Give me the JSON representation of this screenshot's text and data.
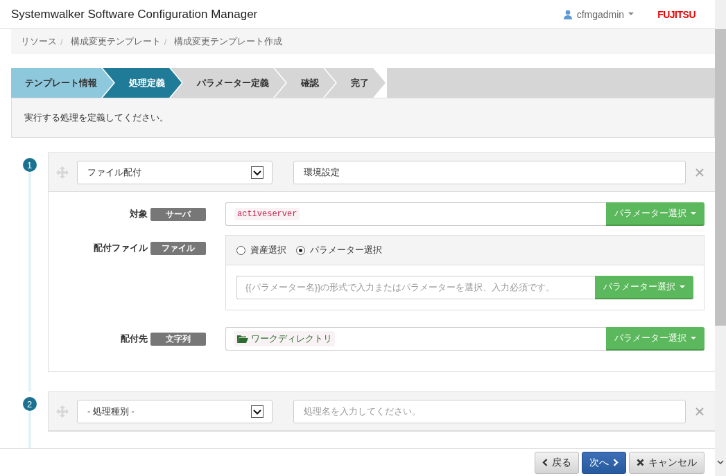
{
  "header": {
    "title": "Systemwalker Software Configuration Manager",
    "user": "cfmgadmin",
    "logo": "FUJITSU"
  },
  "breadcrumb": [
    {
      "label": "リソース",
      "separator": "/"
    },
    {
      "label": "構成変更テンプレート",
      "separator": "/"
    },
    {
      "label": "構成変更テンプレート作成"
    }
  ],
  "steps": [
    {
      "label": "テンプレート情報",
      "completed": true,
      "selected": false
    },
    {
      "label": "処理定義",
      "selected": true
    },
    {
      "label": "パラメーター定義",
      "completed": false,
      "selected": false
    },
    {
      "label": "確認",
      "completed": false,
      "selected": false
    },
    {
      "label": "完了",
      "completed": false,
      "selected": false
    }
  ],
  "instruction": "実行する処理を定義してください。",
  "processes": [
    {
      "number": "1",
      "type": "ファイル配付",
      "name": "環境設定",
      "fields": [
        {
          "kind": "param",
          "label": "対象",
          "type": "サーバ",
          "value": {
            "kind": "code",
            "text": "activeserver"
          },
          "button": "パラメーター選択"
        },
        {
          "kind": "choice",
          "label": "配付ファイル",
          "type": "ファイル",
          "options": [
            {
              "label": "資産選択",
              "selected": false
            },
            {
              "label": "パラメーター選択",
              "selected": true
            }
          ],
          "placeholder": "{{パラメーター名}}の形式で入力またはパラメーターを選択、入力必須です。",
          "button": "パラメーター選択"
        },
        {
          "kind": "param",
          "label": "配付先",
          "type": "文字列",
          "value": {
            "kind": "folder",
            "text": "ワークディレクトリ"
          },
          "button": "パラメーター選択"
        }
      ]
    },
    {
      "number": "2",
      "type": "- 処理種別 -",
      "name_placeholder": "処理名を入力してください。"
    }
  ],
  "footer": [
    {
      "label": "戻る",
      "kind": "back"
    },
    {
      "label": "次へ",
      "kind": "next"
    },
    {
      "label": "キャンセル",
      "kind": "cancel"
    }
  ]
}
